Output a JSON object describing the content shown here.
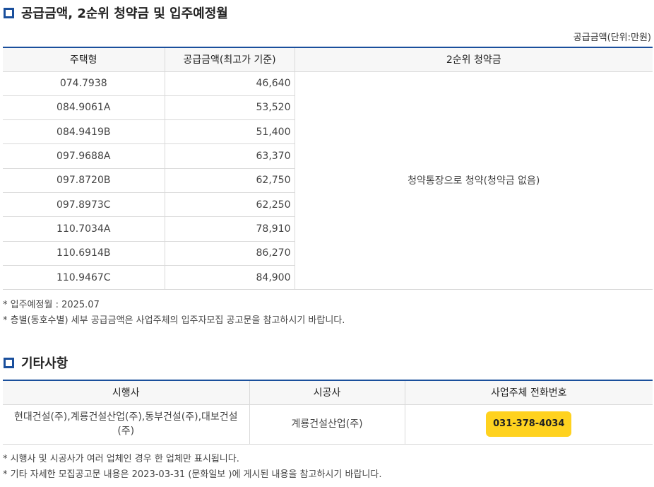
{
  "supply": {
    "title": "공급금액, 2순위 청약금 및 입주예정월",
    "unit_note": "공급금액(단위:만원)",
    "headers": [
      "주택형",
      "공급금액(최고가 기준)",
      "2순위 청약금"
    ],
    "rows": [
      {
        "type": "074.7938",
        "amount": "46,640"
      },
      {
        "type": "084.9061A",
        "amount": "53,520"
      },
      {
        "type": "084.9419B",
        "amount": "51,400"
      },
      {
        "type": "097.9688A",
        "amount": "63,370"
      },
      {
        "type": "097.8720B",
        "amount": "62,750"
      },
      {
        "type": "097.8973C",
        "amount": "62,250"
      },
      {
        "type": "110.7034A",
        "amount": "78,910"
      },
      {
        "type": "110.6914B",
        "amount": "86,270"
      },
      {
        "type": "110.9467C",
        "amount": "84,900"
      }
    ],
    "second_deposit": "청약통장으로 청약(청약금 없음)",
    "notes": [
      "* 입주예정월 : 2025.07",
      "* 층별(동호수별) 세부 공급금액은 사업주체의 입주자모집 공고문을 참고하시기 바랍니다."
    ]
  },
  "etc": {
    "title": "기타사항",
    "headers": [
      "시행사",
      "시공사",
      "사업주체 전화번호"
    ],
    "developer": "현대건설(주),계룡건설산업(주),동부건설(주),대보건설(주)",
    "constructor": "계룡건설산업(주)",
    "phone": "031-378-4034",
    "notes": [
      "* 시행사 및 시공사가 여러 업체인 경우 한 업체만 표시됩니다.",
      "* 기타 자세한 모집공고문 내용은 2023-03-31 (문화일보 )에 게시된 내용을 참고하시기 바랍니다."
    ]
  },
  "colors": {
    "accent": "#1a4f9c",
    "phone_badge": "#ffd21f"
  }
}
